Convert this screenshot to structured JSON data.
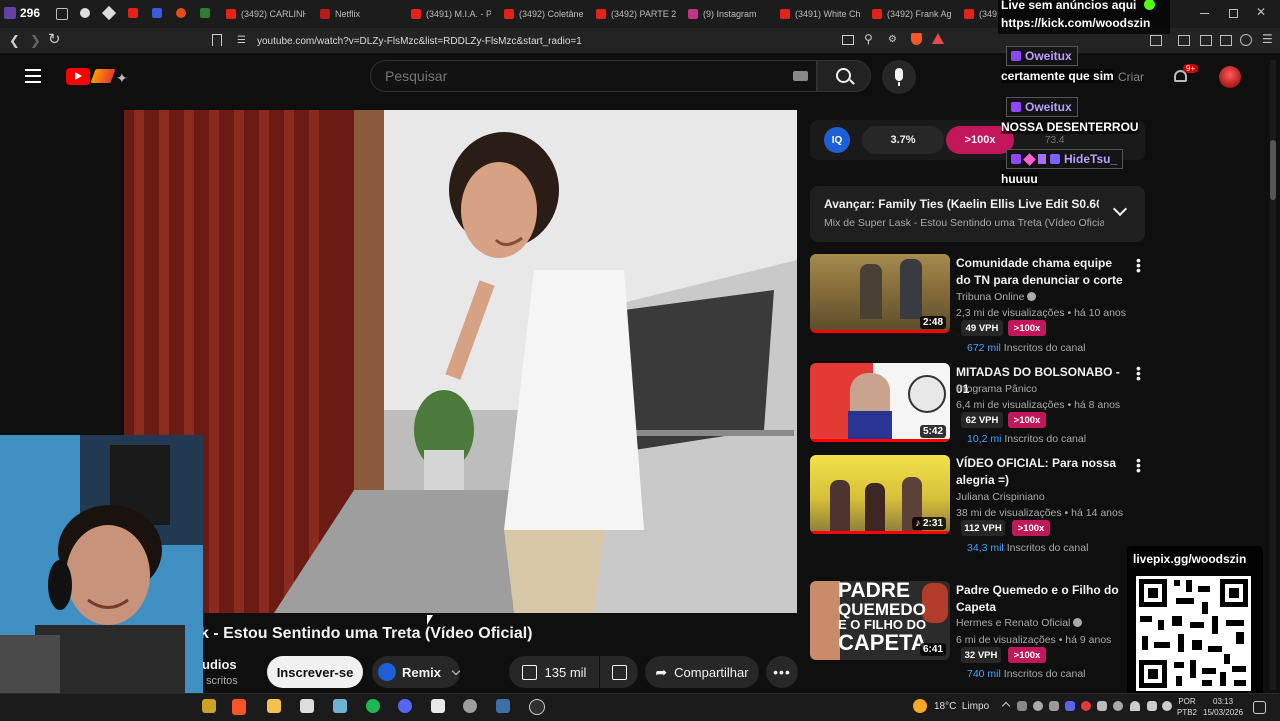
{
  "browser": {
    "tab_counter": "296",
    "tabs": [
      {
        "label": "(3492) CARLINH..."
      },
      {
        "label": "Netflix"
      },
      {
        "label": "(3491) M.I.A. - P..."
      },
      {
        "label": "(3492) Coletâne..."
      },
      {
        "label": "(3492) PARTE 2..."
      },
      {
        "label": "(9) Instagram"
      },
      {
        "label": "(3491) White Ch..."
      },
      {
        "label": "(3492) Frank Ag..."
      },
      {
        "label": "(349..."
      }
    ],
    "url": "youtube.com/watch?v=DLZy-FlsMzc&list=RDDLZy-FlsMzc&start_radio=1"
  },
  "youtube": {
    "search_placeholder": "Pesquisar",
    "create_label": "Criar",
    "notifications_badge": "9+"
  },
  "stats_bar": {
    "iq": "IQ",
    "percent": "3.7%",
    "multiplier": ">100x",
    "score": "73.4"
  },
  "next_up": {
    "title": "Avançar: Family Ties (Kaelin Ellis Live Edit S0.60) (...",
    "subtitle": "Mix de Super Lask - Estou Sentindo uma Treta (Vídeo Oficial)"
  },
  "recommendations": [
    {
      "title": "Comunidade chama equipe do TN para denunciar o corte de ...",
      "channel": "Tribuna Online",
      "verified": true,
      "stats": "2,3 mi de visualizações • há 10 anos",
      "vph": "49 VPH",
      "mult": ">100x",
      "subs_num": "672 mil",
      "subs_label": "Inscritos do canal",
      "duration": "2:48"
    },
    {
      "title": "MITADAS DO BOLSONABO - 01",
      "channel": "Programa Pânico",
      "verified": false,
      "stats": "6,4 mi de visualizações • há 8 anos",
      "vph": "62 VPH",
      "mult": ">100x",
      "subs_num": "10,2 mi",
      "subs_label": "Inscritos do canal",
      "duration": "5:42"
    },
    {
      "title": "VÍDEO OFICIAL: Para nossa alegria =)",
      "channel": "Juliana Crispiniano",
      "verified": false,
      "stats": "38 mi de visualizações • há 14 anos",
      "vph": "112 VPH",
      "mult": ">100x",
      "subs_num": "34,3 mil",
      "subs_label": "Inscritos do canal",
      "duration": "2:31"
    },
    {
      "title": "Padre Quemedo e o Filho do Capeta",
      "channel": "Hermes e Renato Oficial",
      "verified": true,
      "stats": "6 mi de visualizações • há 9 anos",
      "vph": "32 VPH",
      "mult": ">100x",
      "subs_num": "740 mil",
      "subs_label": "Inscritos do canal",
      "duration": "6:41"
    }
  ],
  "thumb_text": {
    "padre": "PADRE",
    "quemedo": "QUEMEDO",
    "filho": "E O FILHO DO",
    "capeta": "CAPETA"
  },
  "video": {
    "title": "k - Estou Sentindo uma Treta (Vídeo Oficial)",
    "channel_partial": "udios",
    "subs_partial": "scritos",
    "subscribe_label": "Inscrever-se",
    "remix_label": "Remix",
    "likes": "135 mil",
    "share_label": "Compartilhar"
  },
  "stream_overlay": {
    "header_line1": "Live sem anúncios aqui",
    "header_line2": "https://kick.com/woodszin",
    "messages": [
      {
        "user": "Oweitux",
        "text": "certamente que sim"
      },
      {
        "user": "Oweitux",
        "text": "NOSSA DESENTERROU"
      },
      {
        "user": "HideTsu_",
        "text": "huuuu"
      }
    ],
    "livepix": "livepix.gg/woodszin"
  },
  "taskbar": {
    "weather": "18°C  Limpo",
    "lang1": "POR",
    "lang2": "PTB2",
    "time": "03:13",
    "date": "15/03/2026"
  },
  "colors": {
    "accent_red": "#e62117",
    "link_blue": "#3ea6ff",
    "pink": "#c2185b",
    "bg": "#0f0f0f"
  }
}
